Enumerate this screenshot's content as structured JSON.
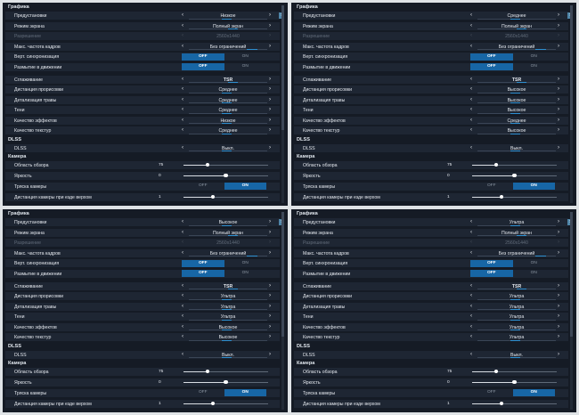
{
  "labels": {
    "graphics": "Графика",
    "presets": "Предустановки",
    "screen_mode": "Режим экрана",
    "resolution": "Разрешение",
    "max_fps": "Макс. частота кадров",
    "vsync": "Верт. синхронизация",
    "motion_blur": "Размытие в движении",
    "antialiasing": "Сглаживание",
    "draw_distance": "Дистанция прорисовки",
    "grass_detail": "Детализация травы",
    "shadows": "Тени",
    "effects_quality": "Качество эффектов",
    "texture_quality": "Качество текстур",
    "dlss_section": "DLSS",
    "dlss": "DLSS",
    "camera": "Камера",
    "fov": "Область обзора",
    "brightness": "Яркость",
    "camera_shake": "Тряска камеры",
    "ride_camera_distance": "Дистанция камеры при езде верхом",
    "off": "OFF",
    "on": "ON"
  },
  "panels": [
    {
      "presets": "Низкое",
      "screen_mode": "Полный экран",
      "resolution": "2560x1440",
      "max_fps": "Без ограничений",
      "vsync": "OFF",
      "motion_blur": "OFF",
      "antialiasing": "TSR",
      "draw_distance": "Среднее",
      "grass_detail": "Среднее",
      "shadows": "Среднее",
      "effects_quality": "Низкое",
      "texture_quality": "Среднее",
      "dlss": "Выкл.",
      "fov": "75",
      "brightness": "0",
      "camera_shake": "ON",
      "ride_camera_distance": "1"
    },
    {
      "presets": "Среднее",
      "screen_mode": "Полный экран",
      "resolution": "2560x1440",
      "max_fps": "Без ограничений",
      "vsync": "OFF",
      "motion_blur": "OFF",
      "antialiasing": "TSR",
      "draw_distance": "Высокое",
      "grass_detail": "Высокое",
      "shadows": "Высокое",
      "effects_quality": "Среднее",
      "texture_quality": "Высокое",
      "dlss": "Выкл.",
      "fov": "75",
      "brightness": "0",
      "camera_shake": "ON",
      "ride_camera_distance": "1"
    },
    {
      "presets": "Высокое",
      "screen_mode": "Полный экран",
      "resolution": "2560x1440",
      "max_fps": "Без ограничений",
      "vsync": "OFF",
      "motion_blur": "OFF",
      "antialiasing": "TSR",
      "draw_distance": "Ультра",
      "grass_detail": "Ультра",
      "shadows": "Ультра",
      "effects_quality": "Высокое",
      "texture_quality": "Высокое",
      "dlss": "Выкл.",
      "fov": "75",
      "brightness": "0",
      "camera_shake": "ON",
      "ride_camera_distance": "1"
    },
    {
      "presets": "Ультра",
      "screen_mode": "Полный экран",
      "resolution": "2560x1440",
      "max_fps": "Без ограничений",
      "vsync": "OFF",
      "motion_blur": "OFF",
      "antialiasing": "TSR",
      "draw_distance": "Ультра",
      "grass_detail": "Ультра",
      "shadows": "Ультра",
      "effects_quality": "Ультра",
      "texture_quality": "Ультра",
      "dlss": "Выкл.",
      "fov": "75",
      "brightness": "0",
      "camera_shake": "ON",
      "ride_camera_distance": "1"
    }
  ],
  "slider_levels": {
    "fov": 0.28,
    "brightness": 0.5,
    "ride_camera_distance": 0.35
  },
  "colors": {
    "accent": "#2e8fd0",
    "toggle_active": "#1766a5",
    "panel_bg": "#151b25",
    "row_bg": "#1e2633"
  }
}
